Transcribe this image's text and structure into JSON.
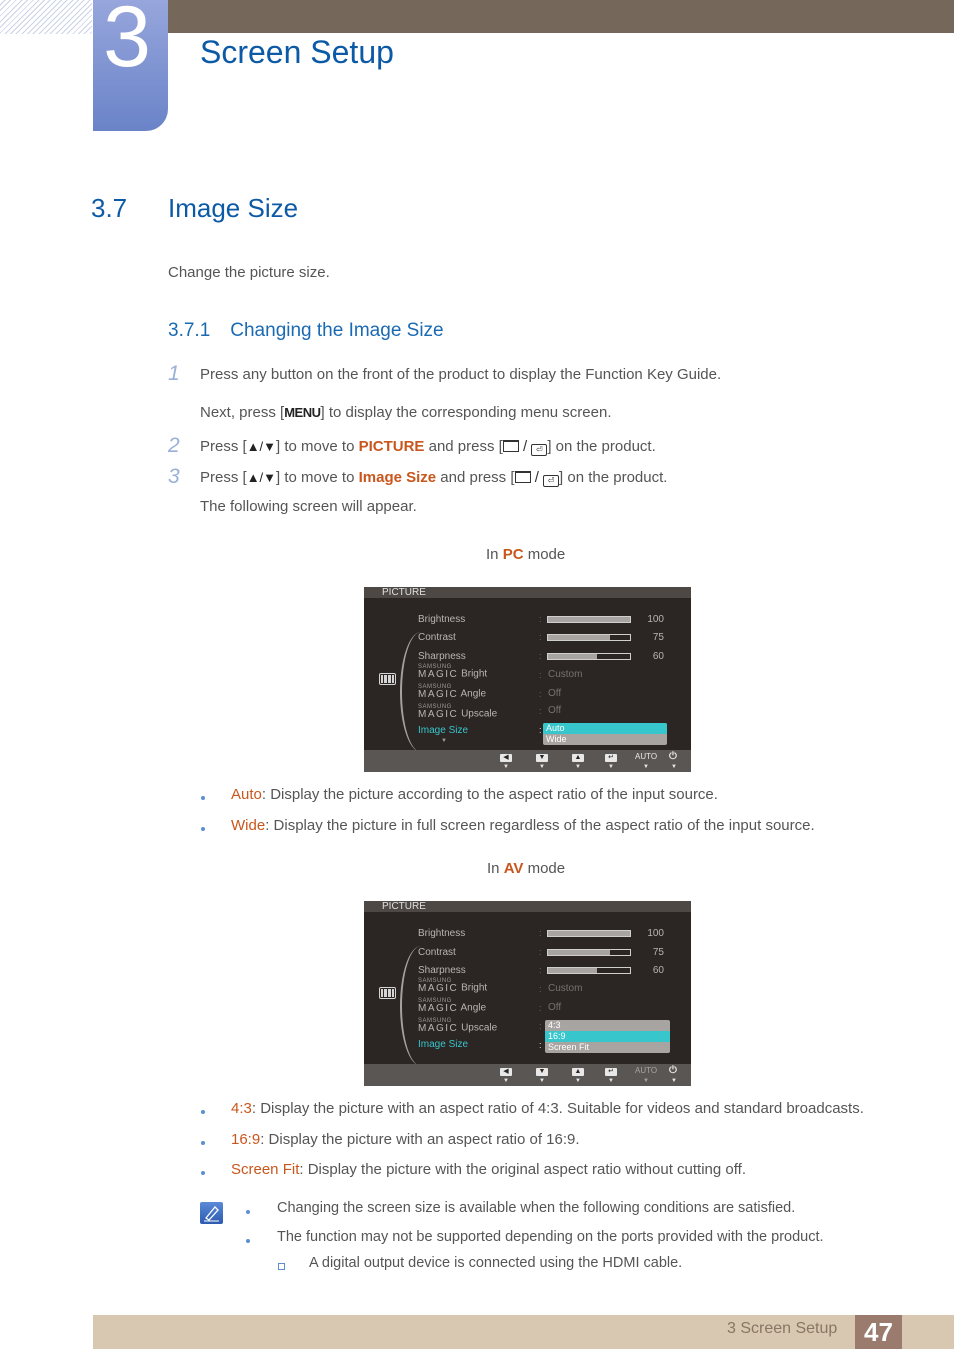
{
  "header": {
    "chapter_number": "3",
    "chapter_title": "Screen Setup"
  },
  "section": {
    "number": "3.7",
    "title": "Image Size",
    "intro": "Change the picture size."
  },
  "subsection": {
    "number": "3.7.1",
    "title": "Changing the Image Size"
  },
  "steps": [
    {
      "num": "1",
      "line1": "Press any button on the front of the product to display the Function Key Guide.",
      "line2_pre": "Next, press [",
      "line2_key": "MENU",
      "line2_post": "] to display the corresponding menu screen."
    },
    {
      "num": "2",
      "pre": "Press [",
      "keys": "▲/▼",
      "mid": "] to move to ",
      "target": "PICTURE",
      "mid2": " and press [",
      "post": "] on the product."
    },
    {
      "num": "3",
      "pre": "Press [",
      "keys": "▲/▼",
      "mid": "] to move to ",
      "target": "Image Size",
      "mid2": " and press [",
      "post": "] on the product.",
      "line2": "The following screen will appear."
    }
  ],
  "pc_mode": {
    "caption_pre": "In ",
    "caption_mode": "PC",
    "caption_post": " mode",
    "osd": {
      "title": "PICTURE",
      "rows": [
        {
          "label": "Brightness",
          "value": "100",
          "level": 1.0
        },
        {
          "label": "Contrast",
          "value": "75",
          "level": 0.75
        },
        {
          "label": "Sharpness",
          "value": "60",
          "level": 0.6
        }
      ],
      "magic_rows": [
        {
          "brand_top": "SAMSUNG",
          "brand": "MAGIC",
          "label": "Bright",
          "value": "Custom"
        },
        {
          "brand_top": "SAMSUNG",
          "brand": "MAGIC",
          "label": "Angle",
          "value": "Off"
        },
        {
          "brand_top": "SAMSUNG",
          "brand": "MAGIC",
          "label": "Upscale",
          "value": "Off"
        }
      ],
      "active_label": "Image Size",
      "options": [
        "Auto",
        "Wide"
      ],
      "selected": "Auto",
      "footer": {
        "auto": "AUTO"
      }
    },
    "bullets": [
      {
        "term": "Auto",
        "text": ": Display the picture according to the aspect ratio of the input source."
      },
      {
        "term": "Wide",
        "text": ": Display the picture in full screen regardless of the aspect ratio of the input source."
      }
    ]
  },
  "av_mode": {
    "caption_pre": "In ",
    "caption_mode": "AV",
    "caption_post": " mode",
    "osd": {
      "title": "PICTURE",
      "rows": [
        {
          "label": "Brightness",
          "value": "100",
          "level": 1.0
        },
        {
          "label": "Contrast",
          "value": "75",
          "level": 0.75
        },
        {
          "label": "Sharpness",
          "value": "60",
          "level": 0.6
        }
      ],
      "magic_rows": [
        {
          "brand_top": "SAMSUNG",
          "brand": "MAGIC",
          "label": "Bright",
          "value": "Custom"
        },
        {
          "brand_top": "SAMSUNG",
          "brand": "MAGIC",
          "label": "Angle",
          "value": "Off"
        },
        {
          "brand_top": "SAMSUNG",
          "brand": "MAGIC",
          "label": "Upscale",
          "value": ""
        }
      ],
      "active_label": "Image Size",
      "options": [
        "4:3",
        "16:9",
        "Screen Fit"
      ],
      "selected": "16:9",
      "footer": {
        "auto": "AUTO"
      }
    },
    "bullets": [
      {
        "term": "4:3",
        "text": ": Display the picture with an aspect ratio of 4:3. Suitable for videos and standard broadcasts."
      },
      {
        "term": "16:9",
        "text": ": Display the picture with an aspect ratio of 16:9."
      },
      {
        "term": "Screen Fit",
        "text": ": Display the picture with the original aspect ratio without cutting off."
      }
    ]
  },
  "note": {
    "icon": "note-pencil-icon",
    "items": [
      "Changing the screen size is available when the following conditions are satisfied.",
      "The function may not be supported depending on the ports provided with the product."
    ],
    "subitems": [
      "A digital output device is connected using the HDMI cable."
    ]
  },
  "footer": {
    "label": "3 Screen Setup",
    "page": "47"
  },
  "colors": {
    "heading_blue": "#0c5aa6",
    "highlight_orange": "#c9561d",
    "osd_cyan": "#36c6cc",
    "topbar_brown": "#75685a",
    "footer_tan": "#d8c8b2",
    "page_box": "#9a7b6d"
  }
}
